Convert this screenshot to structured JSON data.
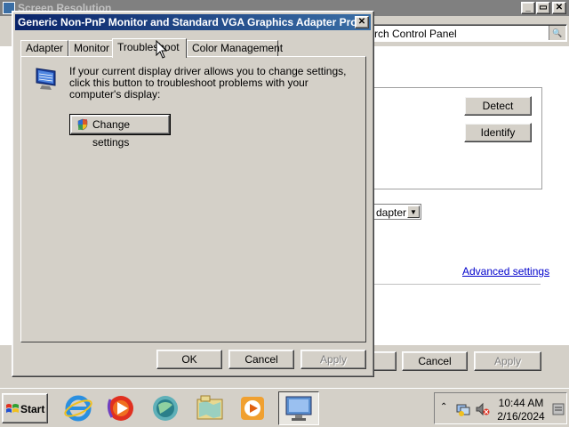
{
  "background_window": {
    "title": "Screen Resolution",
    "address_text": "rch Control Panel",
    "buttons": {
      "detect": "Detect",
      "identify": "Identify",
      "cancel": "Cancel",
      "apply": "Apply"
    },
    "adapter_dropdown_text": "dapter",
    "advanced_link": "Advanced settings"
  },
  "dialog": {
    "title": "Generic Non-PnP Monitor and Standard VGA Graphics Adapter Pro...",
    "close_symbol": "✕",
    "tabs": [
      {
        "label": "Adapter",
        "active": false
      },
      {
        "label": "Monitor",
        "active": false
      },
      {
        "label": "Troubleshoot",
        "active": true
      },
      {
        "label": "Color Management",
        "active": false
      }
    ],
    "troubleshoot": {
      "description": "If your current display driver allows you to change settings, click this button to troubleshoot problems with your computer's display:",
      "change_settings_label": "Change settings"
    },
    "buttons": {
      "ok": "OK",
      "cancel": "Cancel",
      "apply": "Apply"
    }
  },
  "taskbar": {
    "start_label": "Start",
    "clock_time": "10:44 AM",
    "clock_date": "2/16/2024",
    "icons": [
      "internet-explorer-icon",
      "media-player-icon",
      "network-globe-icon",
      "map-folder-icon",
      "media-center-icon",
      "display-settings-icon"
    ]
  },
  "colors": {
    "titlebar_active_start": "#0a246a",
    "titlebar_active_end": "#3a6ea5",
    "titlebar_inactive": "#808080",
    "face": "#d4d0c8",
    "link": "#0000cc"
  }
}
